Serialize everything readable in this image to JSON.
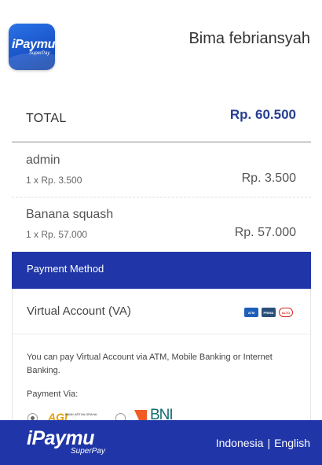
{
  "header": {
    "logo_text": "iPaymu",
    "logo_subtext": "SuperPay",
    "user_name": "Bima febriansyah"
  },
  "summary": {
    "total_label": "TOTAL",
    "total_value": "Rp. 60.500"
  },
  "items": [
    {
      "name": "admin",
      "qty": "1 x Rp. 3.500",
      "price": "Rp. 3.500"
    },
    {
      "name": "Banana squash",
      "qty": "1 x Rp. 57.000",
      "price": "Rp. 57.000"
    }
  ],
  "payment": {
    "section_title": "Payment Method",
    "method_label": "Virtual Account (VA)",
    "method_icons": [
      "atm-bersama-icon",
      "prima-icon",
      "alto-icon"
    ],
    "description": "You can pay Virtual Account via ATM, Mobile Banking or Internet Banking.",
    "via_label": "Payment Via:",
    "banks": [
      {
        "name": "agi-bank-logo",
        "logo_text": "AGI",
        "logo_subtext": "BANK ARTHA GRAHA",
        "selected": true
      },
      {
        "name": "bni-bank-logo",
        "logo_text": "BNI",
        "selected": false
      }
    ]
  },
  "footer": {
    "brand": "iPaymu",
    "brand_sub": "SuperPay",
    "lang_id": "Indonesia",
    "lang_sep": "|",
    "lang_en": "English"
  },
  "colors": {
    "primary_blue": "#2036a8",
    "total_text": "#263f8f"
  }
}
